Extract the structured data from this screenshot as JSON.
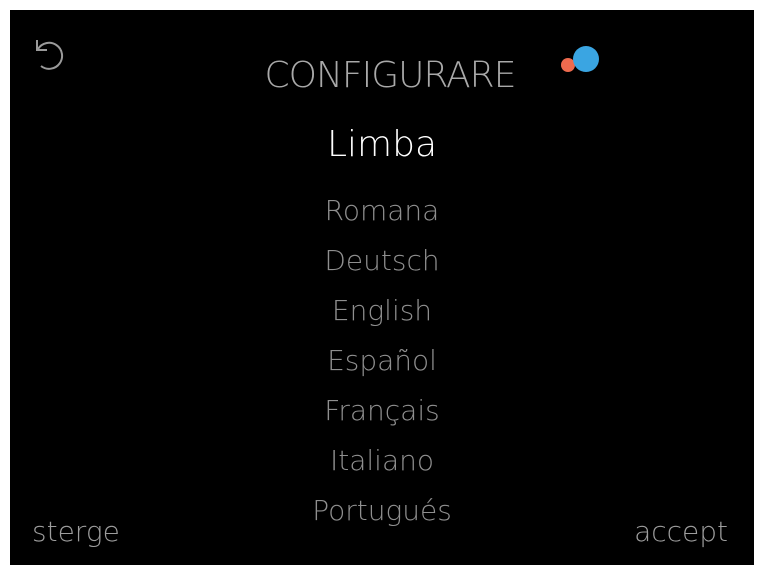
{
  "header": {
    "title": "CONFIGURARE",
    "back_icon": "undo-arrow-icon",
    "indicator": {
      "red_color": "#ee6a4e",
      "blue_color": "#3aa5e2"
    }
  },
  "main": {
    "heading": "Limba",
    "languages": [
      {
        "label": "Romana"
      },
      {
        "label": "Deutsch"
      },
      {
        "label": "English"
      },
      {
        "label": "Español"
      },
      {
        "label": "Français"
      },
      {
        "label": "Italiano"
      },
      {
        "label": "Portugués"
      }
    ]
  },
  "footer": {
    "left_label": "sterge",
    "right_label": "accept"
  }
}
